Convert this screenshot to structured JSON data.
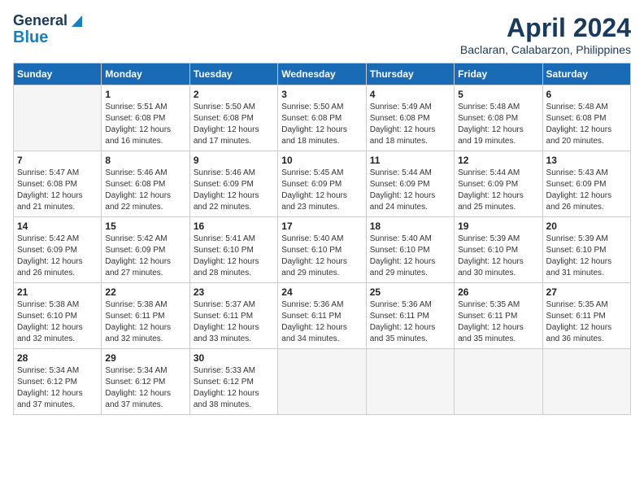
{
  "header": {
    "logo_line1": "General",
    "logo_line2": "Blue",
    "title": "April 2024",
    "subtitle": "Baclaran, Calabarzon, Philippines"
  },
  "days_of_week": [
    "Sunday",
    "Monday",
    "Tuesday",
    "Wednesday",
    "Thursday",
    "Friday",
    "Saturday"
  ],
  "weeks": [
    [
      {
        "day": "",
        "info": ""
      },
      {
        "day": "1",
        "info": "Sunrise: 5:51 AM\nSunset: 6:08 PM\nDaylight: 12 hours\nand 16 minutes."
      },
      {
        "day": "2",
        "info": "Sunrise: 5:50 AM\nSunset: 6:08 PM\nDaylight: 12 hours\nand 17 minutes."
      },
      {
        "day": "3",
        "info": "Sunrise: 5:50 AM\nSunset: 6:08 PM\nDaylight: 12 hours\nand 18 minutes."
      },
      {
        "day": "4",
        "info": "Sunrise: 5:49 AM\nSunset: 6:08 PM\nDaylight: 12 hours\nand 18 minutes."
      },
      {
        "day": "5",
        "info": "Sunrise: 5:48 AM\nSunset: 6:08 PM\nDaylight: 12 hours\nand 19 minutes."
      },
      {
        "day": "6",
        "info": "Sunrise: 5:48 AM\nSunset: 6:08 PM\nDaylight: 12 hours\nand 20 minutes."
      }
    ],
    [
      {
        "day": "7",
        "info": "Sunrise: 5:47 AM\nSunset: 6:08 PM\nDaylight: 12 hours\nand 21 minutes."
      },
      {
        "day": "8",
        "info": "Sunrise: 5:46 AM\nSunset: 6:08 PM\nDaylight: 12 hours\nand 22 minutes."
      },
      {
        "day": "9",
        "info": "Sunrise: 5:46 AM\nSunset: 6:09 PM\nDaylight: 12 hours\nand 22 minutes."
      },
      {
        "day": "10",
        "info": "Sunrise: 5:45 AM\nSunset: 6:09 PM\nDaylight: 12 hours\nand 23 minutes."
      },
      {
        "day": "11",
        "info": "Sunrise: 5:44 AM\nSunset: 6:09 PM\nDaylight: 12 hours\nand 24 minutes."
      },
      {
        "day": "12",
        "info": "Sunrise: 5:44 AM\nSunset: 6:09 PM\nDaylight: 12 hours\nand 25 minutes."
      },
      {
        "day": "13",
        "info": "Sunrise: 5:43 AM\nSunset: 6:09 PM\nDaylight: 12 hours\nand 26 minutes."
      }
    ],
    [
      {
        "day": "14",
        "info": "Sunrise: 5:42 AM\nSunset: 6:09 PM\nDaylight: 12 hours\nand 26 minutes."
      },
      {
        "day": "15",
        "info": "Sunrise: 5:42 AM\nSunset: 6:09 PM\nDaylight: 12 hours\nand 27 minutes."
      },
      {
        "day": "16",
        "info": "Sunrise: 5:41 AM\nSunset: 6:10 PM\nDaylight: 12 hours\nand 28 minutes."
      },
      {
        "day": "17",
        "info": "Sunrise: 5:40 AM\nSunset: 6:10 PM\nDaylight: 12 hours\nand 29 minutes."
      },
      {
        "day": "18",
        "info": "Sunrise: 5:40 AM\nSunset: 6:10 PM\nDaylight: 12 hours\nand 29 minutes."
      },
      {
        "day": "19",
        "info": "Sunrise: 5:39 AM\nSunset: 6:10 PM\nDaylight: 12 hours\nand 30 minutes."
      },
      {
        "day": "20",
        "info": "Sunrise: 5:39 AM\nSunset: 6:10 PM\nDaylight: 12 hours\nand 31 minutes."
      }
    ],
    [
      {
        "day": "21",
        "info": "Sunrise: 5:38 AM\nSunset: 6:10 PM\nDaylight: 12 hours\nand 32 minutes."
      },
      {
        "day": "22",
        "info": "Sunrise: 5:38 AM\nSunset: 6:11 PM\nDaylight: 12 hours\nand 32 minutes."
      },
      {
        "day": "23",
        "info": "Sunrise: 5:37 AM\nSunset: 6:11 PM\nDaylight: 12 hours\nand 33 minutes."
      },
      {
        "day": "24",
        "info": "Sunrise: 5:36 AM\nSunset: 6:11 PM\nDaylight: 12 hours\nand 34 minutes."
      },
      {
        "day": "25",
        "info": "Sunrise: 5:36 AM\nSunset: 6:11 PM\nDaylight: 12 hours\nand 35 minutes."
      },
      {
        "day": "26",
        "info": "Sunrise: 5:35 AM\nSunset: 6:11 PM\nDaylight: 12 hours\nand 35 minutes."
      },
      {
        "day": "27",
        "info": "Sunrise: 5:35 AM\nSunset: 6:11 PM\nDaylight: 12 hours\nand 36 minutes."
      }
    ],
    [
      {
        "day": "28",
        "info": "Sunrise: 5:34 AM\nSunset: 6:12 PM\nDaylight: 12 hours\nand 37 minutes."
      },
      {
        "day": "29",
        "info": "Sunrise: 5:34 AM\nSunset: 6:12 PM\nDaylight: 12 hours\nand 37 minutes."
      },
      {
        "day": "30",
        "info": "Sunrise: 5:33 AM\nSunset: 6:12 PM\nDaylight: 12 hours\nand 38 minutes."
      },
      {
        "day": "",
        "info": ""
      },
      {
        "day": "",
        "info": ""
      },
      {
        "day": "",
        "info": ""
      },
      {
        "day": "",
        "info": ""
      }
    ]
  ]
}
